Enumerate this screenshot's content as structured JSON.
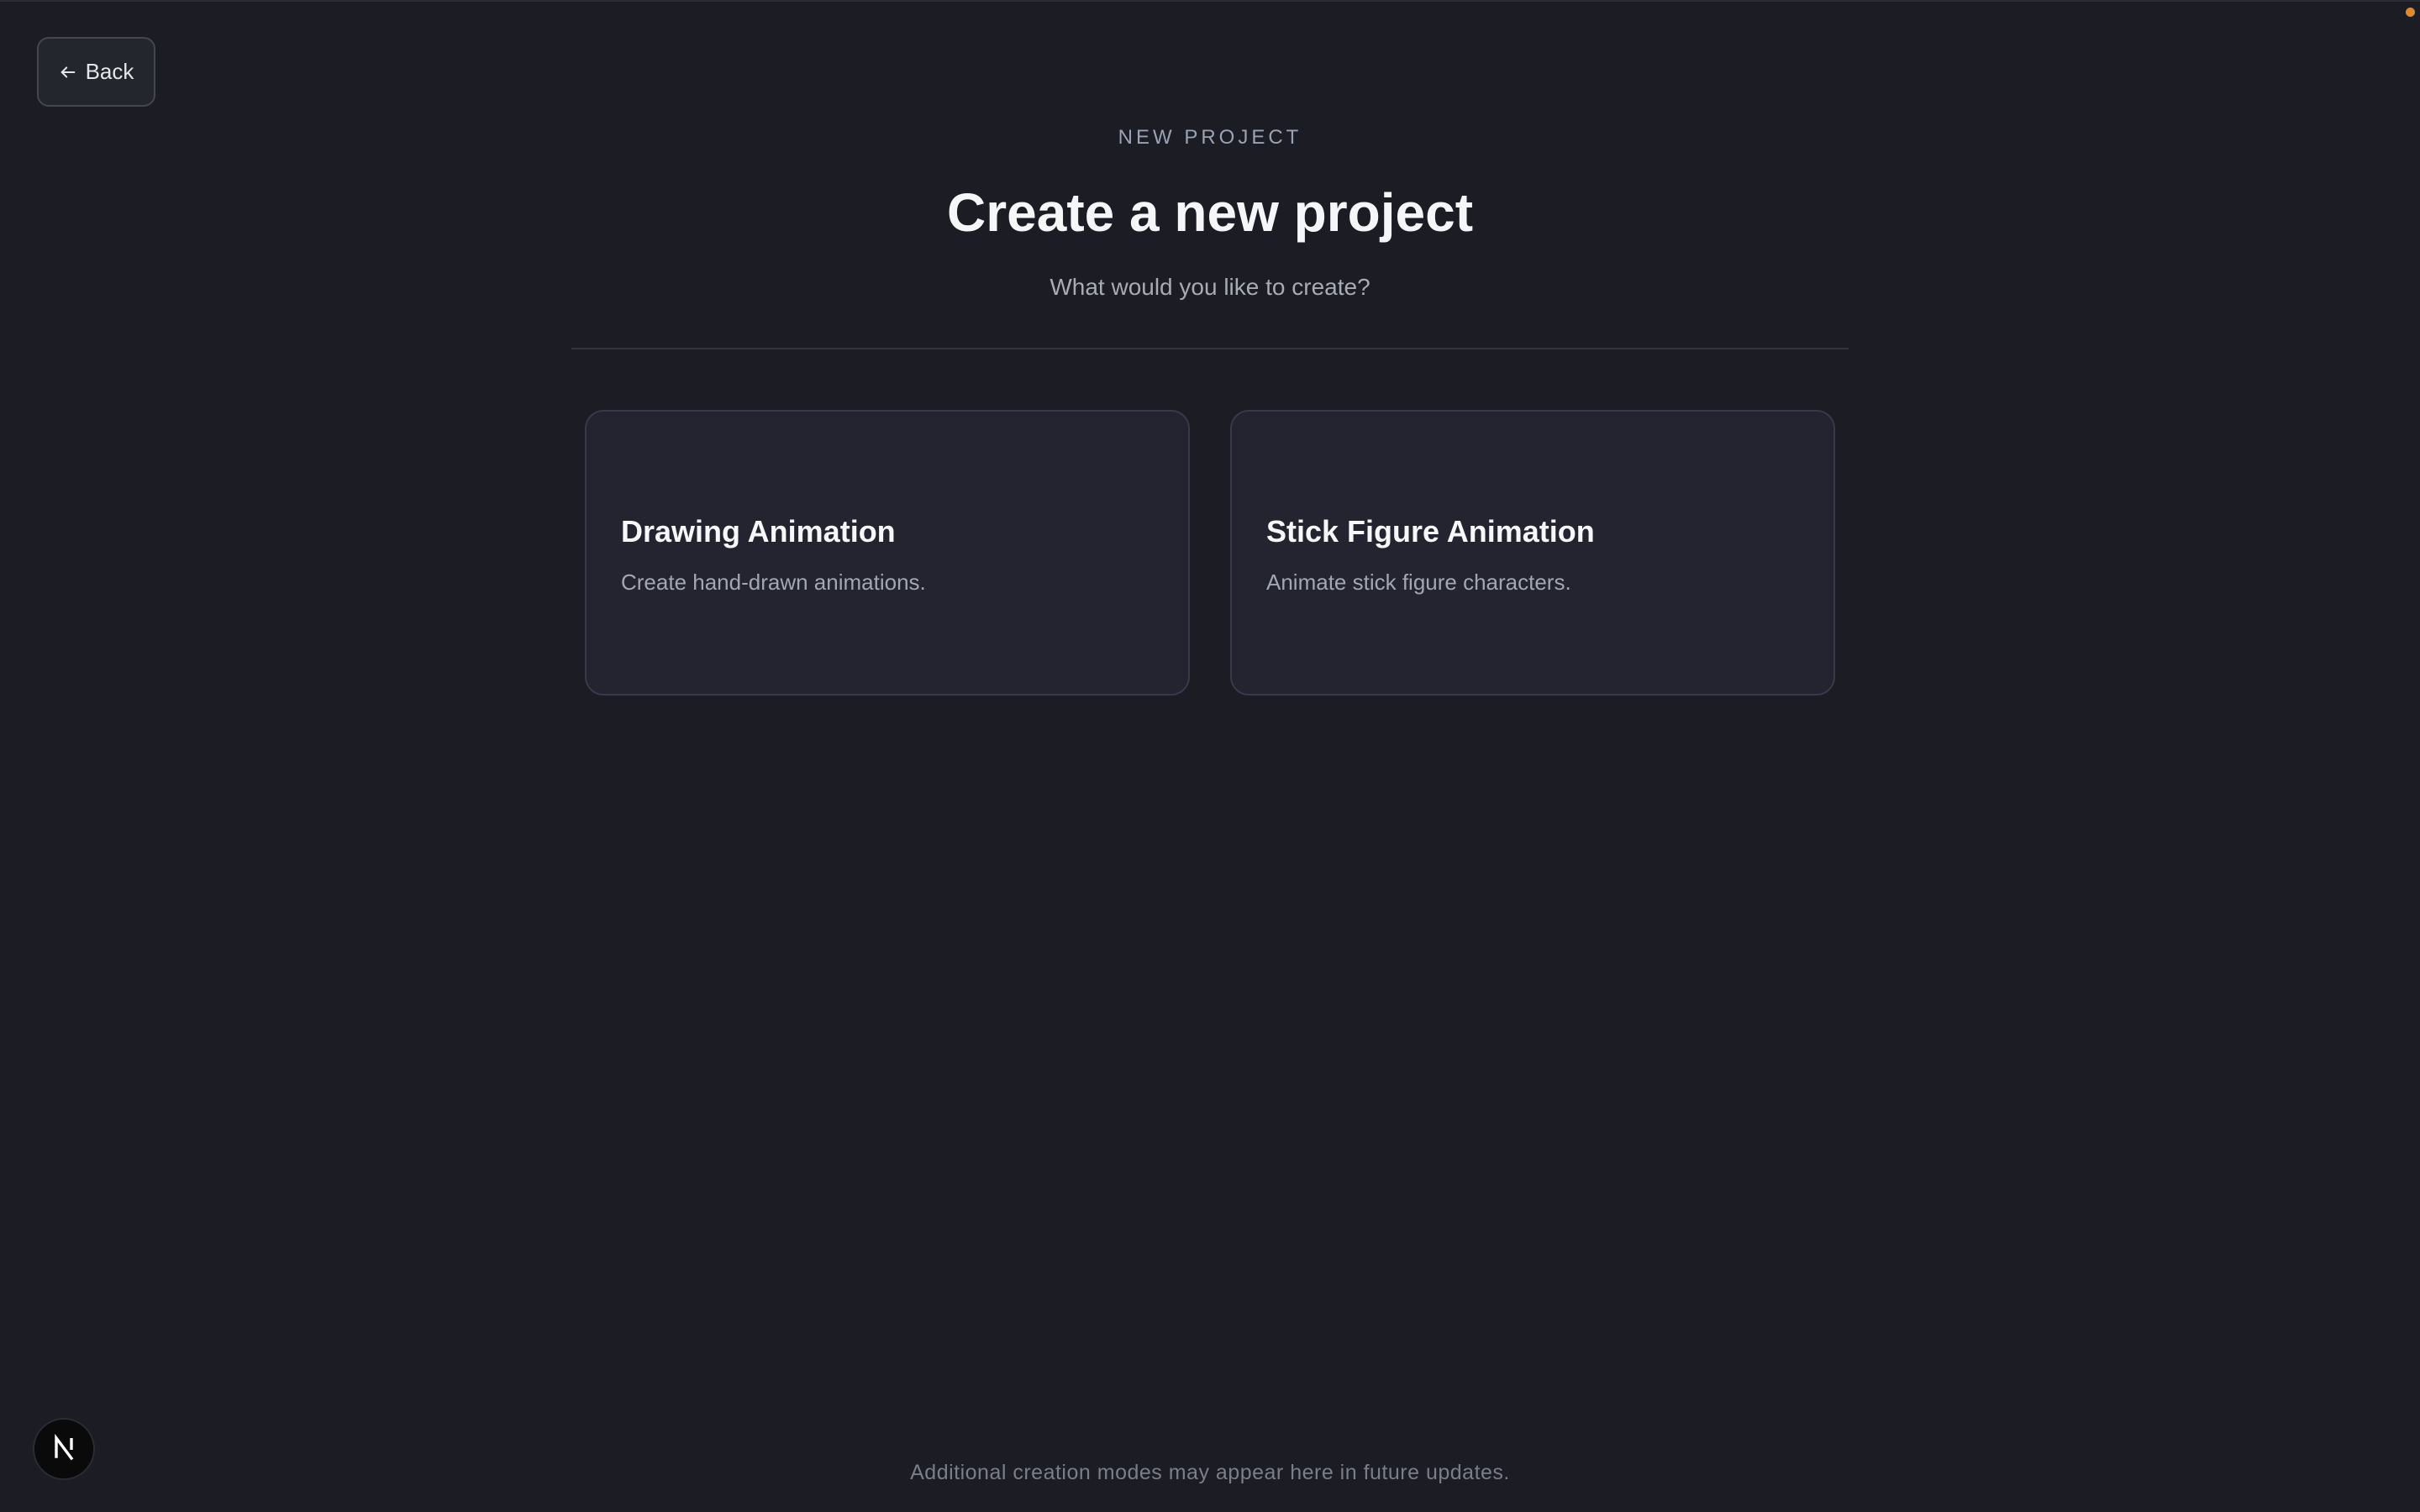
{
  "header": {
    "back_label": "Back",
    "back_icon": "arrow-left-icon"
  },
  "hero": {
    "eyebrow": "NEW PROJECT",
    "title": "Create a new project",
    "subtitle": "What would you like to create?"
  },
  "options": [
    {
      "title": "Drawing Animation",
      "description": "Create hand-drawn animations."
    },
    {
      "title": "Stick Figure Animation",
      "description": "Animate stick figure characters."
    }
  ],
  "footer": {
    "note": "Additional creation modes may appear here in future updates."
  },
  "dev_badge": {
    "icon": "nextjs-logo-icon",
    "letter": "N"
  },
  "colors": {
    "background": "#1b1c24",
    "card_background": "#23242f",
    "card_border": "#353a4c",
    "status_dot": "#e0892b"
  }
}
